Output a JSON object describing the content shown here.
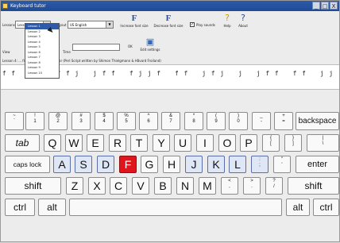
{
  "window": {
    "title": "Keyboard tutor",
    "controls": [
      "_",
      "□",
      "X"
    ]
  },
  "toolbar": {
    "lesson_label": "Lessons",
    "lesson_value": "Lesson 1",
    "layout_label": "Layout",
    "layout_value": "US English",
    "increase_font_label": "Increase font size",
    "decrease_font_label": "Decrease font size",
    "play_sounds_label": "Play sounds",
    "play_sounds_checked": true,
    "help_label": "Help",
    "about_label": "About",
    "view_label": "View",
    "ok_label": "OK",
    "edit_settings_label": "Edit settings",
    "time_label": "Time"
  },
  "lesson_list": [
    "Lesson 1",
    "Lesson 2",
    "Lesson 3",
    "Lesson 4",
    "Lesson 5",
    "Lesson 6",
    "Lesson 7",
    "Lesson 8",
    "Lesson 9",
    "Lesson 10"
  ],
  "credits": "Lesson 4:  ...  from KTouch Typing Tutor (Perl Script written by Shimon Thielgmann & Håvard Froiland)",
  "practice_text": "f f   f j   f f j   j f f   f j j f   f f   j f j   j   j f f   f f   j j",
  "keyboard": {
    "row1": [
      {
        "top": "~",
        "bot": "`"
      },
      {
        "top": "!",
        "bot": "1"
      },
      {
        "top": "@",
        "bot": "2"
      },
      {
        "top": "#",
        "bot": "3"
      },
      {
        "top": "$",
        "bot": "4"
      },
      {
        "top": "%",
        "bot": "5"
      },
      {
        "top": "^",
        "bot": "6"
      },
      {
        "top": "&",
        "bot": "7"
      },
      {
        "top": "*",
        "bot": "8"
      },
      {
        "top": "(",
        "bot": "9"
      },
      {
        "top": ")",
        "bot": "0"
      },
      {
        "top": "_",
        "bot": "-"
      },
      {
        "top": "+",
        "bot": "="
      }
    ],
    "backspace": "backspace",
    "tab": "tab",
    "row2": [
      "Q",
      "W",
      "E",
      "R",
      "T",
      "Y",
      "U",
      "I",
      "O",
      "P"
    ],
    "row2_extra": [
      {
        "top": "{",
        "bot": "["
      },
      {
        "top": "}",
        "bot": "]"
      },
      {
        "top": "|",
        "bot": "\\"
      }
    ],
    "caps": "caps lock",
    "row3": [
      "A",
      "S",
      "D",
      "F",
      "G",
      "H",
      "J",
      "K",
      "L"
    ],
    "row3_extra": [
      {
        "top": ":",
        "bot": ";"
      },
      {
        "top": "\"",
        "bot": "'"
      }
    ],
    "enter": "enter",
    "shift_left": "shift",
    "row4": [
      "Z",
      "X",
      "C",
      "V",
      "B",
      "N",
      "M"
    ],
    "row4_extra": [
      {
        "top": "<",
        "bot": ","
      },
      {
        "top": ">",
        "bot": "."
      },
      {
        "top": "?",
        "bot": "/"
      }
    ],
    "shift_right": "shift",
    "ctrl_left": "ctrl",
    "alt_left": "alt",
    "alt_right": "alt",
    "ctrl_right": "ctrl",
    "active_key": "F",
    "home_keys": [
      "A",
      "S",
      "D",
      "F",
      "J",
      "K",
      "L",
      ";"
    ]
  },
  "colors": {
    "active_key": "#e0141c",
    "home_key": "#dfe6f6",
    "titlebar": "#2d5ba8"
  }
}
